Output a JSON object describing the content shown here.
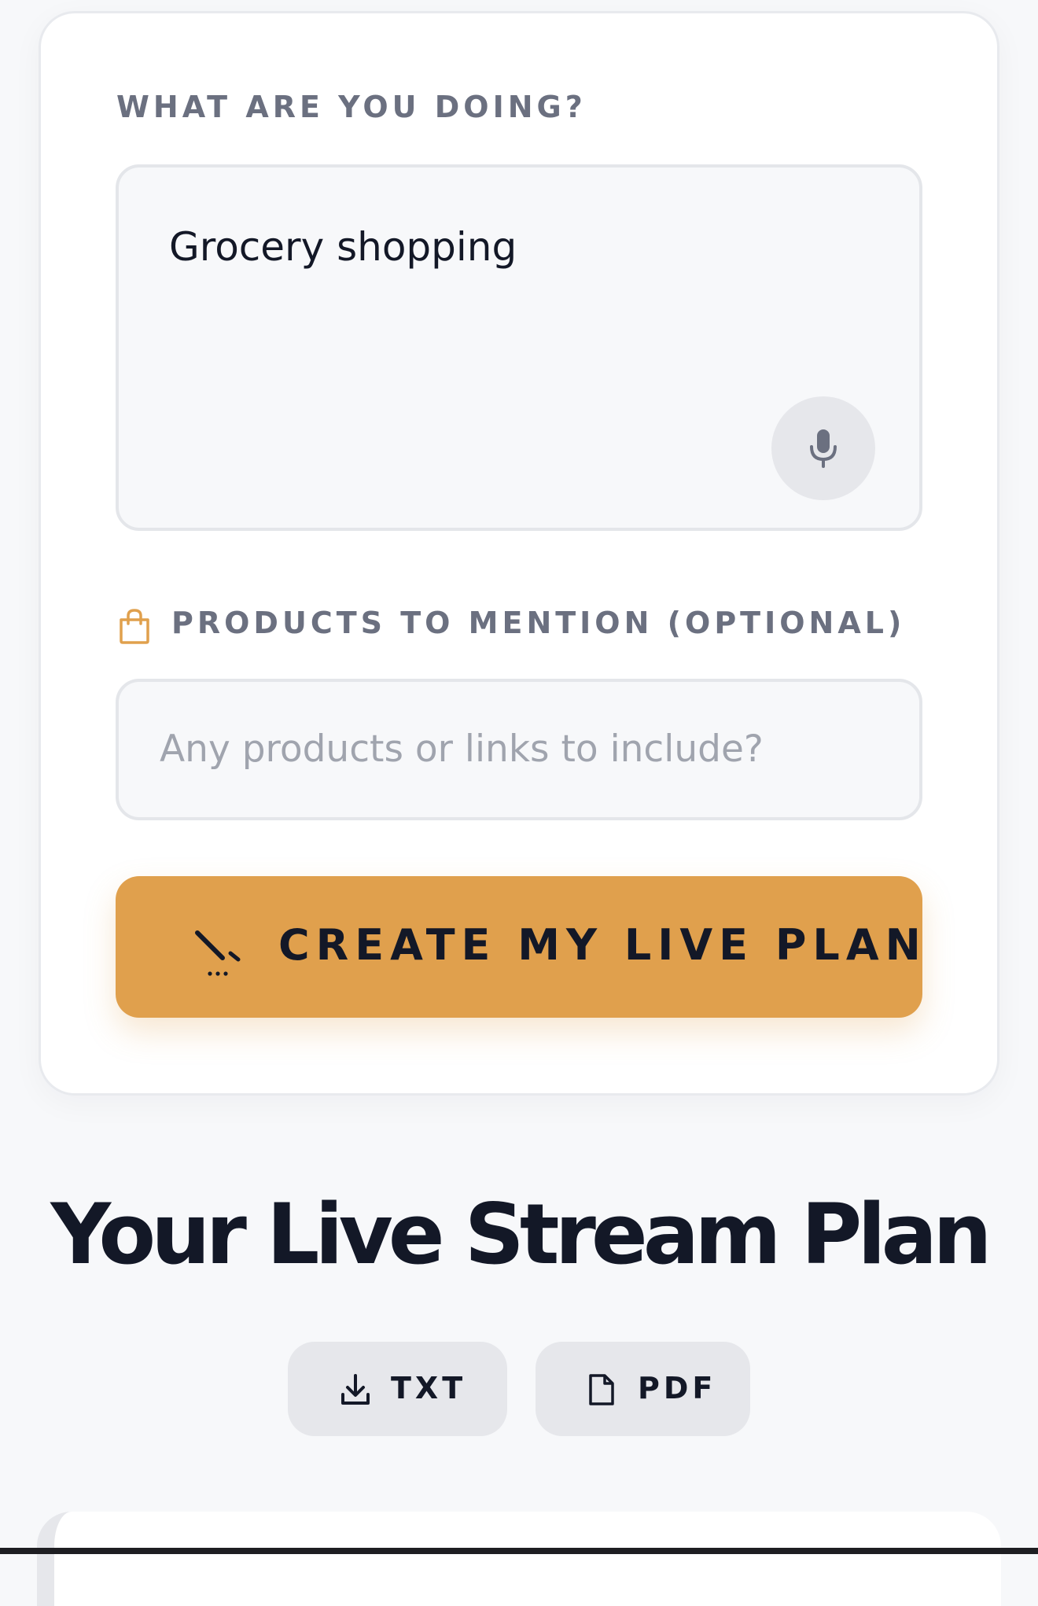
{
  "form": {
    "activity_label": "WHAT ARE YOU DOING?",
    "activity_value": "Grocery shopping",
    "mic_icon": "microphone-icon",
    "products_icon": "shopping-bag-icon",
    "products_label": "PRODUCTS TO MENTION (OPTIONAL)",
    "products_value": "",
    "products_placeholder": "Any products or links to include?",
    "create_icon": "magic-wand-icon",
    "create_label": "CREATE MY LIVE PLAN"
  },
  "plan": {
    "title": "Your Live Stream Plan",
    "export_txt_label": "TXT",
    "export_txt_icon": "download-icon",
    "export_pdf_label": "PDF",
    "export_pdf_icon": "document-icon"
  },
  "colors": {
    "accent": "#e0a04d",
    "text": "#131827",
    "label": "#6b7080",
    "placeholder": "#a0a4ae",
    "field_bg": "#f7f8fa",
    "button_gray": "#e6e7eb"
  }
}
